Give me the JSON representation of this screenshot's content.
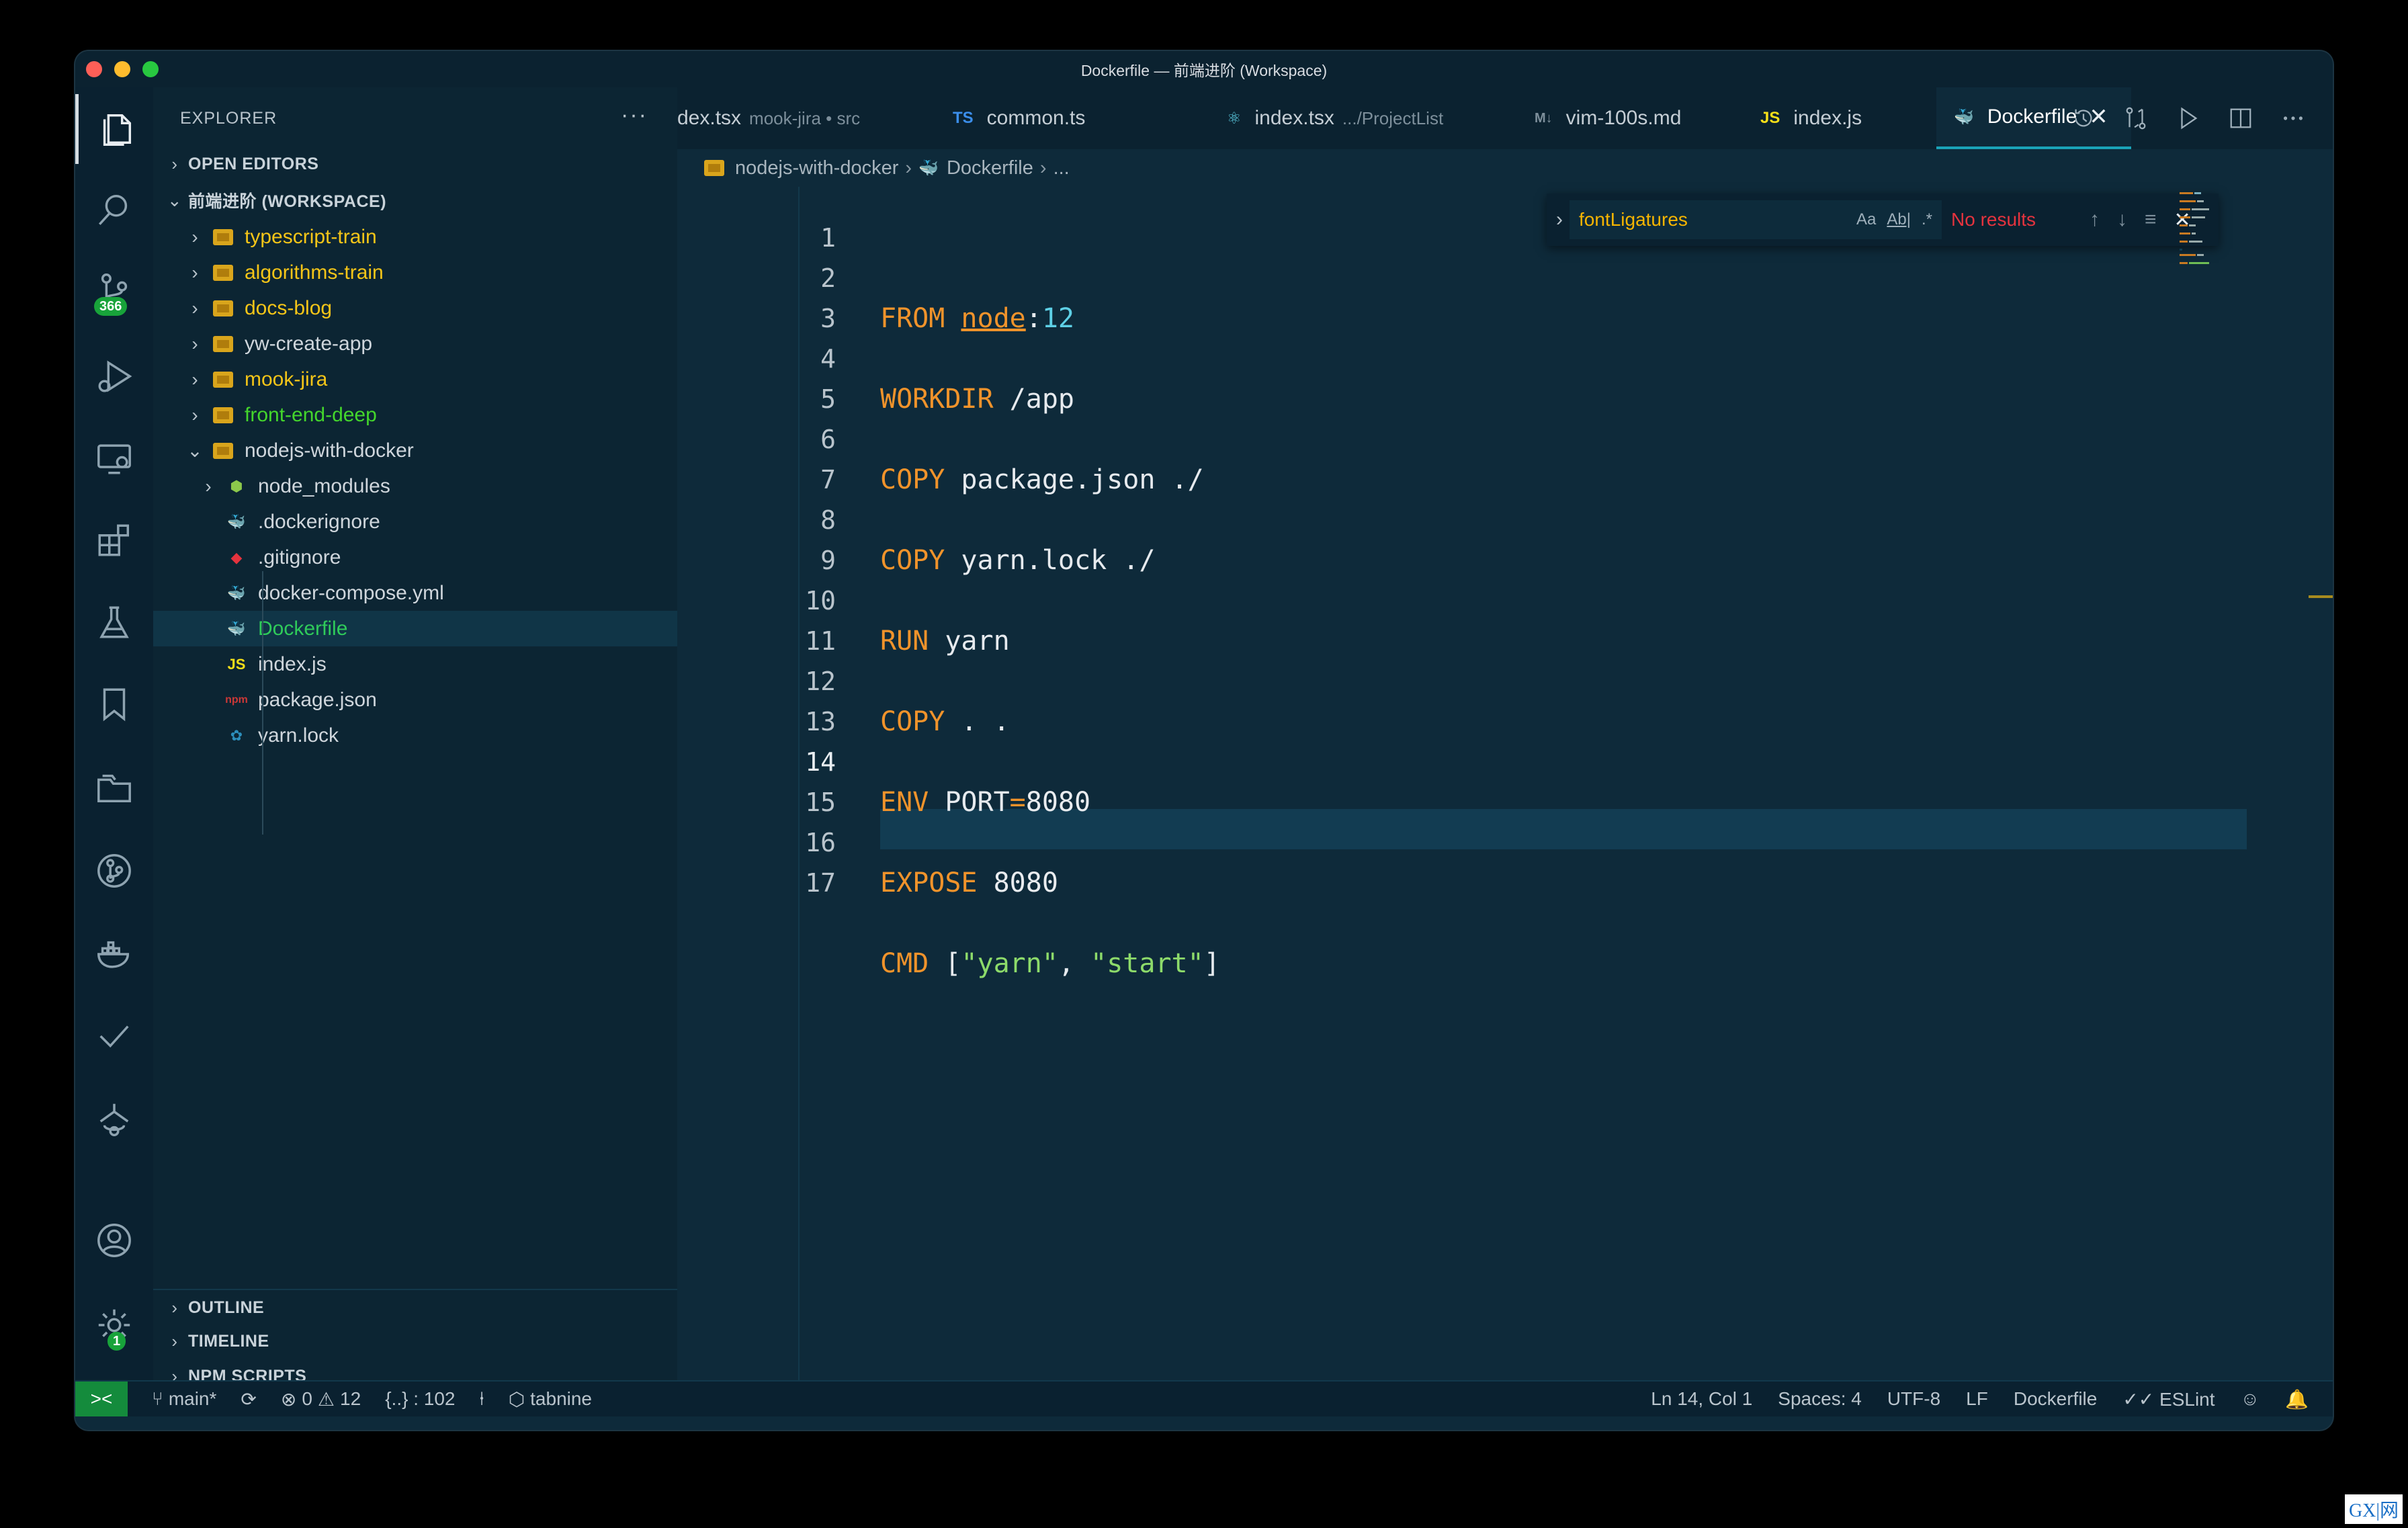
{
  "window": {
    "title": "Dockerfile — 前端进阶 (Workspace)"
  },
  "activity_bar": {
    "source_control_badge": "366",
    "settings_badge": "1"
  },
  "sidebar": {
    "header": "EXPLORER",
    "more": "···",
    "sections": {
      "open_editors": "OPEN EDITORS",
      "workspace": "前端进阶 (WORKSPACE)",
      "outline": "OUTLINE",
      "timeline": "TIMELINE",
      "npm_scripts": "NPM SCRIPTS"
    },
    "tree": [
      {
        "label": "typescript-train",
        "color": "#f5c518"
      },
      {
        "label": "algorithms-train",
        "color": "#f5c518"
      },
      {
        "label": "docs-blog",
        "color": "#f5c518"
      },
      {
        "label": "yw-create-app",
        "color": "#cfd6dc"
      },
      {
        "label": "mook-jira",
        "color": "#f5c518"
      },
      {
        "label": "front-end-deep",
        "color": "#44d62c"
      },
      {
        "label": "nodejs-with-docker",
        "color": "#cfd6dc"
      },
      {
        "label": "node_modules",
        "color": "#cfd6dc"
      },
      {
        "label": ".dockerignore",
        "color": "#cfd6dc"
      },
      {
        "label": ".gitignore",
        "color": "#cfd6dc"
      },
      {
        "label": "docker-compose.yml",
        "color": "#cfd6dc"
      },
      {
        "label": "Dockerfile",
        "color": "#2fcb5a"
      },
      {
        "label": "index.js",
        "color": "#cfd6dc"
      },
      {
        "label": "package.json",
        "color": "#cfd6dc"
      },
      {
        "label": "yarn.lock",
        "color": "#cfd6dc"
      }
    ]
  },
  "tabs": [
    {
      "label": "dex.tsx",
      "desc": "mook-jira • src",
      "icon": ""
    },
    {
      "label": "common.ts",
      "desc": "",
      "icon": "TS"
    },
    {
      "label": "index.tsx",
      "desc": ".../ProjectList",
      "icon": "⚛"
    },
    {
      "label": "vim-100s.md",
      "desc": "",
      "icon": "M↓"
    },
    {
      "label": "index.js",
      "desc": "",
      "icon": "JS"
    },
    {
      "label": "Dockerfile",
      "desc": "",
      "icon": ""
    }
  ],
  "tab_close": "✕",
  "breadcrumb": {
    "folder": "nodejs-with-docker",
    "file": "Dockerfile",
    "rest": "..."
  },
  "find": {
    "value": "fontLigatures",
    "opt_case": "Aa",
    "opt_word": "Ab|",
    "opt_regex": ".*",
    "status": "No results"
  },
  "editor": {
    "line_numbers": [
      "1",
      "2",
      "3",
      "4",
      "5",
      "6",
      "7",
      "8",
      "9",
      "10",
      "11",
      "12",
      "13",
      "14",
      "15",
      "16",
      "17"
    ],
    "lines": {
      "l1_kw": "FROM",
      "l1_img": "node",
      "l1_colon": ":",
      "l1_tag": "12",
      "l3_kw": "WORKDIR",
      "l3_arg": "/app",
      "l5_kw": "COPY",
      "l5_arg": "package.json ./",
      "l7_kw": "COPY",
      "l7_arg": "yarn.lock ./",
      "l9_kw": "RUN",
      "l9_arg": "yarn",
      "l11_kw": "COPY",
      "l11_arg": ". .",
      "l13_kw": "ENV",
      "l13_var": "PORT",
      "l13_eq": "=",
      "l13_val": "8080",
      "l15_kw": "EXPOSE",
      "l15_arg": "8080",
      "l17_kw": "CMD",
      "l17_open": "[",
      "l17_s1": "\"yarn\"",
      "l17_comma": ",",
      "l17_s2": "\"start\"",
      "l17_close": "]"
    }
  },
  "statusbar": {
    "remote": "><",
    "branch": "main*",
    "errors": "0",
    "warnings": "12",
    "symbols": "{..} : 102",
    "tabnine": "tabnine",
    "position": "Ln 14, Col 1",
    "spaces": "Spaces: 4",
    "encoding": "UTF-8",
    "eol": "LF",
    "language": "Dockerfile",
    "eslint": "ESLint"
  },
  "watermark": "GX|网"
}
